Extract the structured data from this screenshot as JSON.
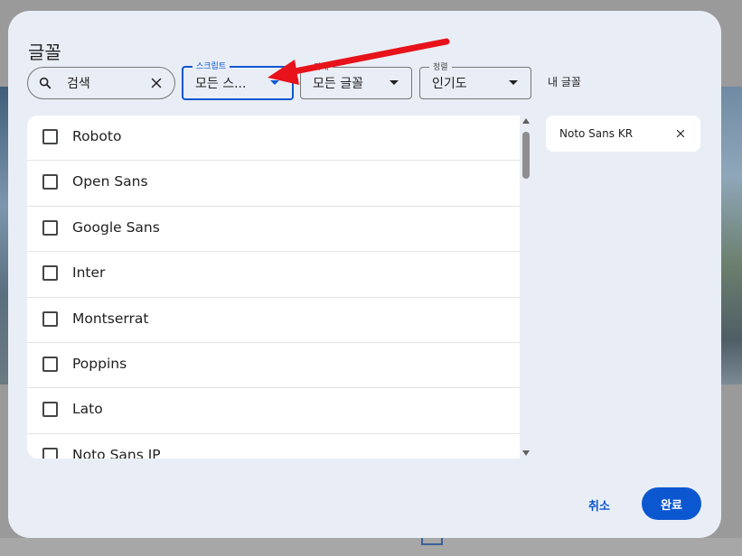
{
  "dialog": {
    "title": "글꼴",
    "search": {
      "value": "검색"
    },
    "filters": [
      {
        "label": "스크립트",
        "value": "모든 스..."
      },
      {
        "label": "카테",
        "value": "모든 글꼴"
      },
      {
        "label": "정렬",
        "value": "인기도"
      }
    ],
    "my_fonts_label": "내 글꼴",
    "font_list": [
      {
        "name": "Roboto"
      },
      {
        "name": "Open Sans"
      },
      {
        "name": "Google Sans"
      },
      {
        "name": "Inter"
      },
      {
        "name": "Montserrat"
      },
      {
        "name": "Poppins"
      },
      {
        "name": "Lato"
      },
      {
        "name": "Noto Sans JP"
      }
    ],
    "selected_fonts": [
      {
        "name": "Noto Sans KR"
      }
    ],
    "cancel_label": "취소",
    "done_label": "완료"
  },
  "colors": {
    "accent": "#0b57d0",
    "dialog_bg": "#e9eef6",
    "annotation_arrow": "#e8121b"
  },
  "icons": {
    "search": "search-icon",
    "clear": "close-icon",
    "dropdown": "caret-down-icon",
    "remove_chip": "close-icon"
  }
}
